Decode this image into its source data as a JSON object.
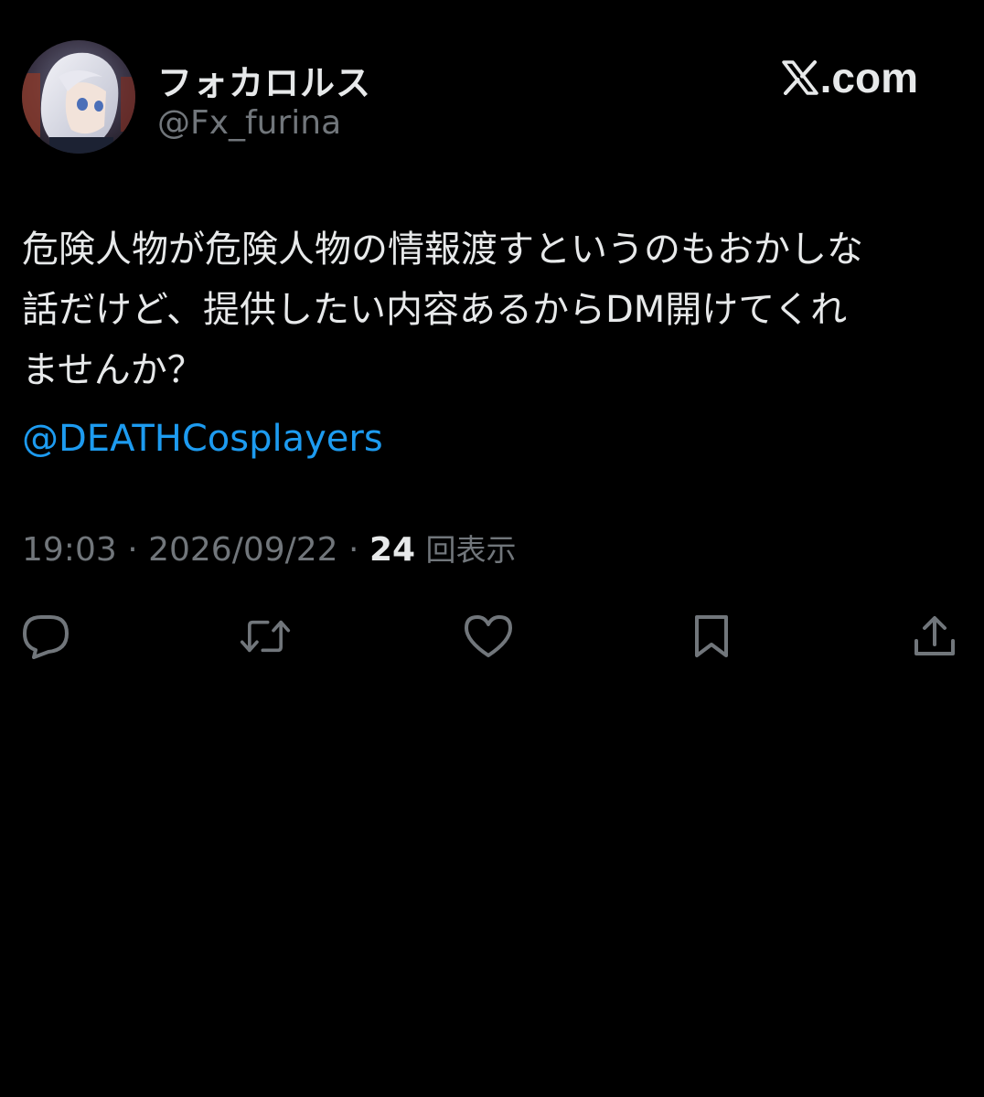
{
  "tweet": {
    "author": {
      "display_name": "フォカロルス",
      "handle": "@Fx_furina"
    },
    "brand_label": ".com",
    "text": "危険人物が危険人物の情報渡すというのもおかしな\n話だけど、提供したい内容あるからDM開けてくれ\nませんか？",
    "mention": "@DEATHCosplayers",
    "time": "19:03",
    "date": "2026/09/22",
    "separator": " · ",
    "views_count": "24",
    "views_label": "回表示"
  },
  "actions": [
    {
      "icon": "reply-icon"
    },
    {
      "icon": "retweet-icon"
    },
    {
      "icon": "like-icon"
    },
    {
      "icon": "bookmark-icon"
    },
    {
      "icon": "share-icon"
    }
  ],
  "colors": {
    "background": "#000000",
    "text": "#e7e9ea",
    "muted": "#71767b",
    "link": "#1d9bf0"
  }
}
